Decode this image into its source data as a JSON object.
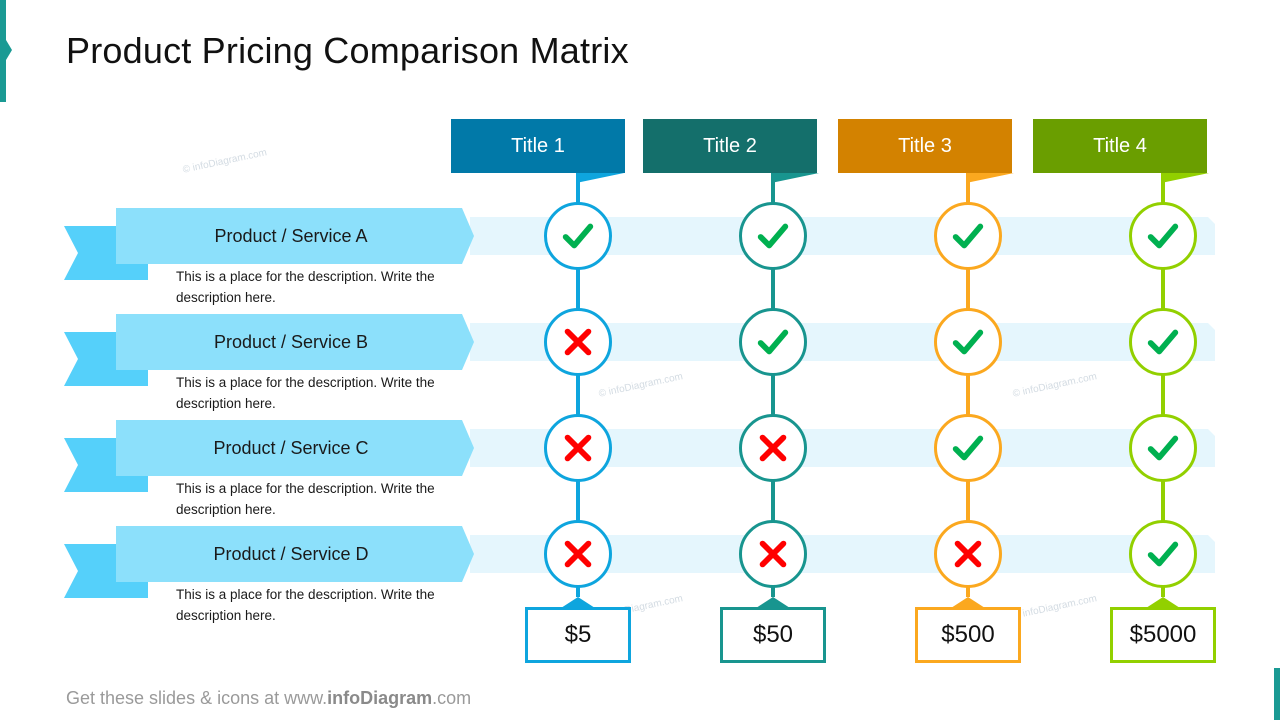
{
  "page": {
    "title": "Product Pricing Comparison Matrix"
  },
  "colors": {
    "accent": "#1a9a94",
    "ribbon_main": "#8ce0fb",
    "ribbon_tail": "#55d0fa",
    "row_band": "#e5f6fd",
    "check": "#00b050",
    "cross": "#ff0000"
  },
  "columns": [
    {
      "title": "Title 1",
      "header_color": "#0179a8",
      "line_color": "#0ea5de",
      "price": "$5"
    },
    {
      "title": "Title 2",
      "header_color": "#146f6b",
      "line_color": "#18958f",
      "price": "$50"
    },
    {
      "title": "Title 3",
      "header_color": "#d38200",
      "line_color": "#fba81f",
      "price": "$500"
    },
    {
      "title": "Title 4",
      "header_color": "#6a9e00",
      "line_color": "#92d000",
      "price": "$5000"
    }
  ],
  "rows": [
    {
      "label": "Product / Service A",
      "description": "This is a place for the description. Write the description here.",
      "marks": [
        "check-icon",
        "check-icon",
        "check-icon",
        "check-icon"
      ]
    },
    {
      "label": "Product / Service B",
      "description": "This is a place for the description. Write the description here.",
      "marks": [
        "cross-icon",
        "check-icon",
        "check-icon",
        "check-icon"
      ]
    },
    {
      "label": "Product / Service C",
      "description": "This is a place for the description. Write the description here.",
      "marks": [
        "cross-icon",
        "cross-icon",
        "check-icon",
        "check-icon"
      ]
    },
    {
      "label": "Product / Service D",
      "description": "This is a place for the description. Write the description here.",
      "marks": [
        "cross-icon",
        "cross-icon",
        "cross-icon",
        "check-icon"
      ]
    }
  ],
  "watermark": "© infoDiagram.com",
  "footer": {
    "prefix": "Get these slides & icons at www.",
    "brand": "infoDiagram",
    "suffix": ".com"
  }
}
